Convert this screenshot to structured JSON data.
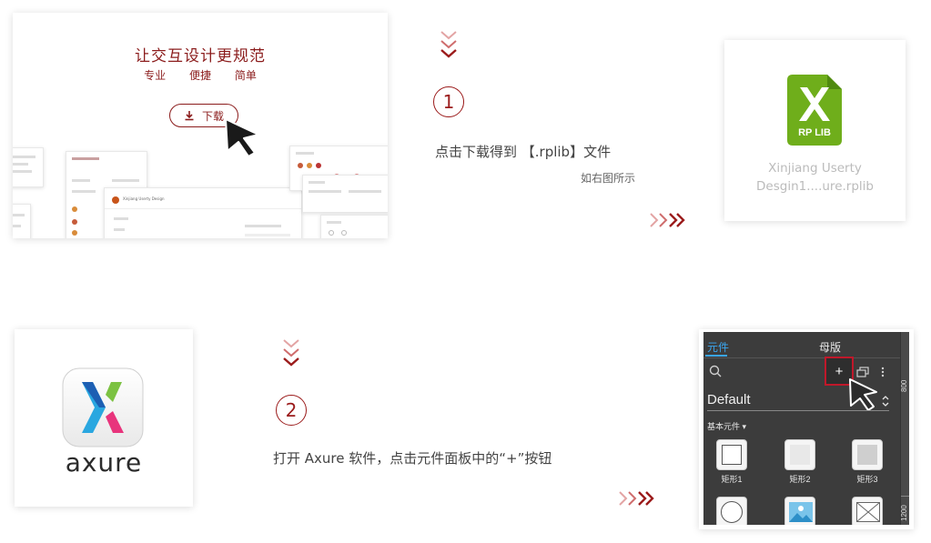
{
  "site_preview": {
    "title": "让交互设计更规范",
    "tags": [
      "专业",
      "便捷",
      "简单"
    ],
    "download_label": "下载",
    "mini_caption": "Xinjiang Userty Design"
  },
  "step1": {
    "number": "1",
    "text": "点击下载得到 【.rplib】文件",
    "subtext": "如右图所示"
  },
  "rplib_card": {
    "badge": "RP LIB",
    "file_name_line1": "Xinjiang Userty",
    "file_name_line2": "Desgin1....ure.rplib",
    "brand_color": "#6fae1b"
  },
  "axure_card": {
    "wordmark": "axure",
    "icon_name": "axure-x-icon"
  },
  "step2": {
    "number": "2",
    "text": "打开 Axure 软件，点击元件面板中的“+”按钮"
  },
  "panel": {
    "tab_widgets": "元件",
    "tab_masters": "母版",
    "add_label": "+",
    "library": "Default",
    "category": "基本元件 ▾",
    "widgets": [
      "矩形1",
      "矩形2",
      "矩形3"
    ],
    "ruler_marks": [
      "800",
      "1200"
    ]
  },
  "colors": {
    "accent": "#9b1b1b",
    "panel_bg": "#3c3c3c",
    "tab_blue": "#3aa6f0",
    "highlight_red": "#c0182a"
  }
}
